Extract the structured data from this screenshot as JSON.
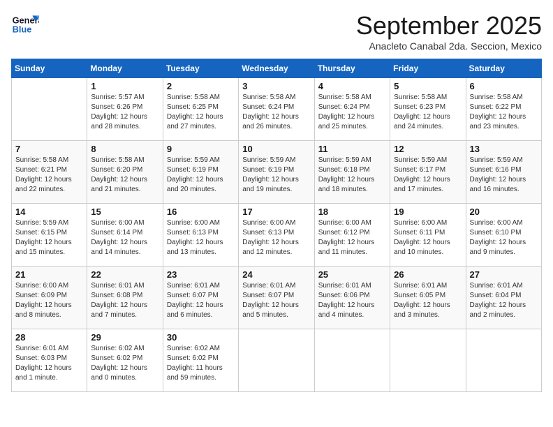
{
  "logo": {
    "line1": "General",
    "line2": "Blue"
  },
  "title": "September 2025",
  "subtitle": "Anacleto Canabal 2da. Seccion, Mexico",
  "days_of_week": [
    "Sunday",
    "Monday",
    "Tuesday",
    "Wednesday",
    "Thursday",
    "Friday",
    "Saturday"
  ],
  "weeks": [
    [
      {
        "day": "",
        "info": ""
      },
      {
        "day": "1",
        "info": "Sunrise: 5:57 AM\nSunset: 6:26 PM\nDaylight: 12 hours\nand 28 minutes."
      },
      {
        "day": "2",
        "info": "Sunrise: 5:58 AM\nSunset: 6:25 PM\nDaylight: 12 hours\nand 27 minutes."
      },
      {
        "day": "3",
        "info": "Sunrise: 5:58 AM\nSunset: 6:24 PM\nDaylight: 12 hours\nand 26 minutes."
      },
      {
        "day": "4",
        "info": "Sunrise: 5:58 AM\nSunset: 6:24 PM\nDaylight: 12 hours\nand 25 minutes."
      },
      {
        "day": "5",
        "info": "Sunrise: 5:58 AM\nSunset: 6:23 PM\nDaylight: 12 hours\nand 24 minutes."
      },
      {
        "day": "6",
        "info": "Sunrise: 5:58 AM\nSunset: 6:22 PM\nDaylight: 12 hours\nand 23 minutes."
      }
    ],
    [
      {
        "day": "7",
        "info": "Sunrise: 5:58 AM\nSunset: 6:21 PM\nDaylight: 12 hours\nand 22 minutes."
      },
      {
        "day": "8",
        "info": "Sunrise: 5:58 AM\nSunset: 6:20 PM\nDaylight: 12 hours\nand 21 minutes."
      },
      {
        "day": "9",
        "info": "Sunrise: 5:59 AM\nSunset: 6:19 PM\nDaylight: 12 hours\nand 20 minutes."
      },
      {
        "day": "10",
        "info": "Sunrise: 5:59 AM\nSunset: 6:19 PM\nDaylight: 12 hours\nand 19 minutes."
      },
      {
        "day": "11",
        "info": "Sunrise: 5:59 AM\nSunset: 6:18 PM\nDaylight: 12 hours\nand 18 minutes."
      },
      {
        "day": "12",
        "info": "Sunrise: 5:59 AM\nSunset: 6:17 PM\nDaylight: 12 hours\nand 17 minutes."
      },
      {
        "day": "13",
        "info": "Sunrise: 5:59 AM\nSunset: 6:16 PM\nDaylight: 12 hours\nand 16 minutes."
      }
    ],
    [
      {
        "day": "14",
        "info": "Sunrise: 5:59 AM\nSunset: 6:15 PM\nDaylight: 12 hours\nand 15 minutes."
      },
      {
        "day": "15",
        "info": "Sunrise: 6:00 AM\nSunset: 6:14 PM\nDaylight: 12 hours\nand 14 minutes."
      },
      {
        "day": "16",
        "info": "Sunrise: 6:00 AM\nSunset: 6:13 PM\nDaylight: 12 hours\nand 13 minutes."
      },
      {
        "day": "17",
        "info": "Sunrise: 6:00 AM\nSunset: 6:13 PM\nDaylight: 12 hours\nand 12 minutes."
      },
      {
        "day": "18",
        "info": "Sunrise: 6:00 AM\nSunset: 6:12 PM\nDaylight: 12 hours\nand 11 minutes."
      },
      {
        "day": "19",
        "info": "Sunrise: 6:00 AM\nSunset: 6:11 PM\nDaylight: 12 hours\nand 10 minutes."
      },
      {
        "day": "20",
        "info": "Sunrise: 6:00 AM\nSunset: 6:10 PM\nDaylight: 12 hours\nand 9 minutes."
      }
    ],
    [
      {
        "day": "21",
        "info": "Sunrise: 6:00 AM\nSunset: 6:09 PM\nDaylight: 12 hours\nand 8 minutes."
      },
      {
        "day": "22",
        "info": "Sunrise: 6:01 AM\nSunset: 6:08 PM\nDaylight: 12 hours\nand 7 minutes."
      },
      {
        "day": "23",
        "info": "Sunrise: 6:01 AM\nSunset: 6:07 PM\nDaylight: 12 hours\nand 6 minutes."
      },
      {
        "day": "24",
        "info": "Sunrise: 6:01 AM\nSunset: 6:07 PM\nDaylight: 12 hours\nand 5 minutes."
      },
      {
        "day": "25",
        "info": "Sunrise: 6:01 AM\nSunset: 6:06 PM\nDaylight: 12 hours\nand 4 minutes."
      },
      {
        "day": "26",
        "info": "Sunrise: 6:01 AM\nSunset: 6:05 PM\nDaylight: 12 hours\nand 3 minutes."
      },
      {
        "day": "27",
        "info": "Sunrise: 6:01 AM\nSunset: 6:04 PM\nDaylight: 12 hours\nand 2 minutes."
      }
    ],
    [
      {
        "day": "28",
        "info": "Sunrise: 6:01 AM\nSunset: 6:03 PM\nDaylight: 12 hours\nand 1 minute."
      },
      {
        "day": "29",
        "info": "Sunrise: 6:02 AM\nSunset: 6:02 PM\nDaylight: 12 hours\nand 0 minutes."
      },
      {
        "day": "30",
        "info": "Sunrise: 6:02 AM\nSunset: 6:02 PM\nDaylight: 11 hours\nand 59 minutes."
      },
      {
        "day": "",
        "info": ""
      },
      {
        "day": "",
        "info": ""
      },
      {
        "day": "",
        "info": ""
      },
      {
        "day": "",
        "info": ""
      }
    ]
  ]
}
